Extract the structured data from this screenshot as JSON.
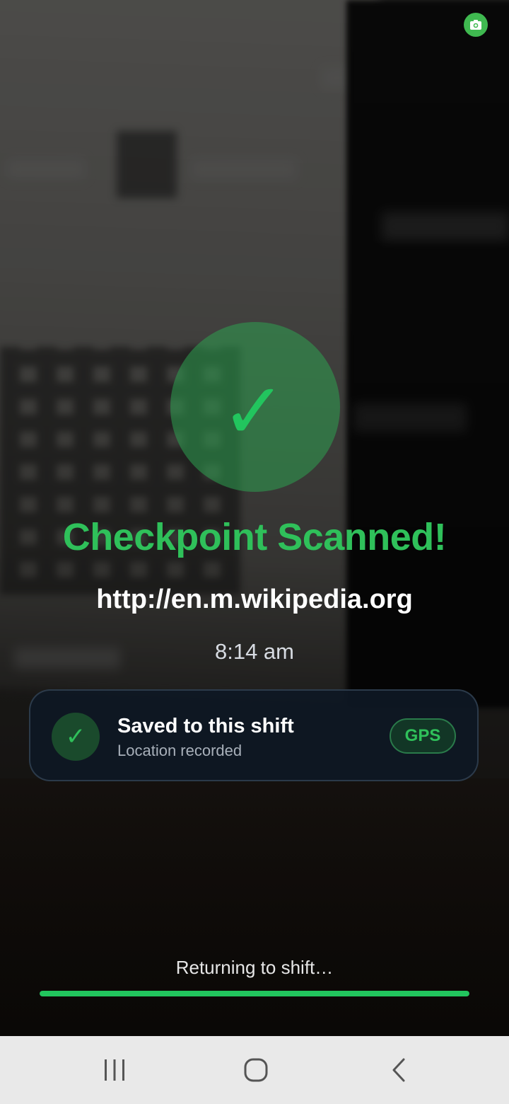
{
  "status": {
    "camera_indicator_icon": "camera-icon",
    "indicator_color": "#3fb950"
  },
  "result": {
    "icon": "checkmark-icon",
    "title": "Checkpoint Scanned!",
    "url": "http://en.m.wikipedia.org",
    "time": "8:14 am",
    "accent_color": "#2fc05a"
  },
  "saved_card": {
    "icon": "checkmark-icon",
    "title": "Saved to this shift",
    "subtitle": "Location recorded",
    "badge": "GPS"
  },
  "footer": {
    "returning_text": "Returning to shift…",
    "progress": 1.0
  },
  "navigation": {
    "recent_apps_icon": "recent-apps-icon",
    "home_icon": "home-icon",
    "back_icon": "back-icon"
  }
}
